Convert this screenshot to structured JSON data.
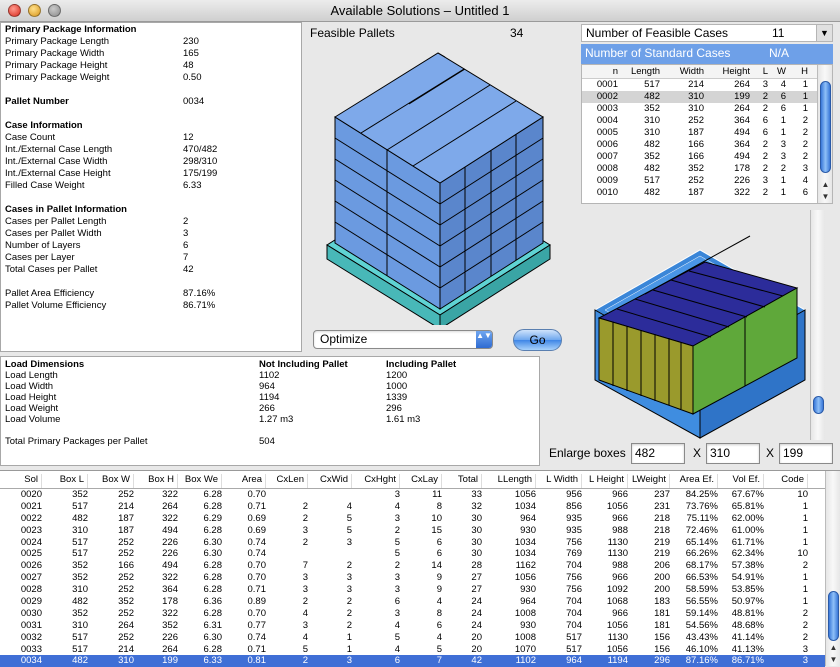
{
  "window": {
    "title": "Available Solutions – Untitled 1"
  },
  "info": {
    "primary_header": "Primary Package Information",
    "primary": [
      [
        "Primary Package Length",
        "230"
      ],
      [
        "Primary Package Width",
        "165"
      ],
      [
        "Primary Package Height",
        "48"
      ],
      [
        "Primary Package Weight",
        "0.50"
      ]
    ],
    "pallet_number": [
      "Pallet Number",
      "0034"
    ],
    "case_header": "Case Information",
    "case": [
      [
        "Case Count",
        "12"
      ],
      [
        "Int./External Case Length",
        "470/482"
      ],
      [
        "Int./External Case Width",
        "298/310"
      ],
      [
        "Int./External Case Height",
        "175/199"
      ],
      [
        "Filled Case Weight",
        "6.33"
      ]
    ],
    "cases_header": "Cases in Pallet Information",
    "cases": [
      [
        "Cases per Pallet Length",
        "2"
      ],
      [
        "Cases per Pallet Width",
        "3"
      ],
      [
        "Number of Layers",
        "6"
      ],
      [
        "Cases per Layer",
        "7"
      ],
      [
        "Total Cases per Pallet",
        "42"
      ]
    ],
    "eff": [
      [
        "Pallet Area Efficiency",
        "87.16%"
      ],
      [
        "Pallet Volume Efficiency",
        "86.71%"
      ]
    ]
  },
  "feasible": {
    "label": "Feasible Pallets",
    "count": "34"
  },
  "optimize": {
    "value": "Optimize",
    "arrow": "▲▼"
  },
  "go_label": "Go",
  "load": {
    "title": "Load Dimensions",
    "col1": "Not Including Pallet",
    "col2": "Including Pallet",
    "rows": [
      [
        "Load Length",
        "1102",
        "1200"
      ],
      [
        "Load Width",
        "964",
        "1000"
      ],
      [
        "Load Height",
        "1194",
        "1339"
      ],
      [
        "Load Weight",
        "266",
        "296"
      ],
      [
        "Load Volume",
        "1.27 m3",
        "1.61 m3"
      ]
    ],
    "total_label": "Total Primary Packages per Pallet",
    "total_value": "504"
  },
  "cases_panel": {
    "nfc_label": "Number of Feasible Cases",
    "nfc_value": "11",
    "nfc_arrow": "▼",
    "nsc_label": "Number of Standard Cases",
    "nsc_value": "N/A",
    "headers": [
      "n",
      "Length",
      "Width",
      "Height",
      "L",
      "W",
      "H"
    ],
    "rows": [
      [
        "0001",
        "517",
        "214",
        "264",
        "3",
        "4",
        "1"
      ],
      [
        "0002",
        "482",
        "310",
        "199",
        "2",
        "6",
        "1"
      ],
      [
        "0003",
        "352",
        "310",
        "264",
        "2",
        "6",
        "1"
      ],
      [
        "0004",
        "310",
        "252",
        "364",
        "6",
        "1",
        "2"
      ],
      [
        "0005",
        "310",
        "187",
        "494",
        "6",
        "1",
        "2"
      ],
      [
        "0006",
        "482",
        "166",
        "364",
        "2",
        "3",
        "2"
      ],
      [
        "0007",
        "352",
        "166",
        "494",
        "2",
        "3",
        "2"
      ],
      [
        "0008",
        "482",
        "352",
        "178",
        "2",
        "2",
        "3"
      ],
      [
        "0009",
        "517",
        "252",
        "226",
        "3",
        "1",
        "4"
      ],
      [
        "0010",
        "482",
        "187",
        "322",
        "2",
        "1",
        "6"
      ]
    ],
    "selected": 1
  },
  "enlarge": {
    "label": "Enlarge boxes",
    "l": "482",
    "w": "310",
    "h": "199",
    "x": "X"
  },
  "solutions": {
    "headers": [
      "Sol",
      "Box L",
      "Box W",
      "Box H",
      "Box We",
      "Area",
      "CxLen",
      "CxWid",
      "CxHght",
      "CxLay",
      "Total",
      "LLength",
      "L Width",
      "L Height",
      "LWeight",
      "Area Ef.",
      "Vol Ef.",
      "Code"
    ],
    "rows": [
      [
        "0020",
        "352",
        "252",
        "322",
        "6.28",
        "0.70",
        "",
        "",
        "3",
        "11",
        "33",
        "1056",
        "956",
        "966",
        "237",
        "84.25%",
        "67.67%",
        "10"
      ],
      [
        "0021",
        "517",
        "214",
        "264",
        "6.28",
        "0.71",
        "2",
        "4",
        "4",
        "8",
        "32",
        "1034",
        "856",
        "1056",
        "231",
        "73.76%",
        "65.81%",
        "1"
      ],
      [
        "0022",
        "482",
        "187",
        "322",
        "6.29",
        "0.69",
        "2",
        "5",
        "3",
        "10",
        "30",
        "964",
        "935",
        "966",
        "218",
        "75.11%",
        "62.00%",
        "1"
      ],
      [
        "0023",
        "310",
        "187",
        "494",
        "6.28",
        "0.69",
        "3",
        "5",
        "2",
        "15",
        "30",
        "930",
        "935",
        "988",
        "218",
        "72.46%",
        "61.00%",
        "1"
      ],
      [
        "0024",
        "517",
        "252",
        "226",
        "6.30",
        "0.74",
        "2",
        "3",
        "5",
        "6",
        "30",
        "1034",
        "756",
        "1130",
        "219",
        "65.14%",
        "61.71%",
        "1"
      ],
      [
        "0025",
        "517",
        "252",
        "226",
        "6.30",
        "0.74",
        "",
        "",
        "5",
        "6",
        "30",
        "1034",
        "769",
        "1130",
        "219",
        "66.26%",
        "62.34%",
        "10"
      ],
      [
        "0026",
        "352",
        "166",
        "494",
        "6.28",
        "0.70",
        "7",
        "2",
        "2",
        "14",
        "28",
        "1162",
        "704",
        "988",
        "206",
        "68.17%",
        "57.38%",
        "2"
      ],
      [
        "0027",
        "352",
        "252",
        "322",
        "6.28",
        "0.70",
        "3",
        "3",
        "3",
        "9",
        "27",
        "1056",
        "756",
        "966",
        "200",
        "66.53%",
        "54.91%",
        "1"
      ],
      [
        "0028",
        "310",
        "252",
        "364",
        "6.28",
        "0.71",
        "3",
        "3",
        "3",
        "9",
        "27",
        "930",
        "756",
        "1092",
        "200",
        "58.59%",
        "53.85%",
        "1"
      ],
      [
        "0029",
        "482",
        "352",
        "178",
        "6.36",
        "0.89",
        "2",
        "2",
        "6",
        "4",
        "24",
        "964",
        "704",
        "1068",
        "183",
        "56.55%",
        "50.97%",
        "1"
      ],
      [
        "0030",
        "352",
        "252",
        "322",
        "6.28",
        "0.70",
        "4",
        "2",
        "3",
        "8",
        "24",
        "1008",
        "704",
        "966",
        "181",
        "59.14%",
        "48.81%",
        "2"
      ],
      [
        "0031",
        "310",
        "264",
        "352",
        "6.31",
        "0.77",
        "3",
        "2",
        "4",
        "6",
        "24",
        "930",
        "704",
        "1056",
        "181",
        "54.56%",
        "48.68%",
        "2"
      ],
      [
        "0032",
        "517",
        "252",
        "226",
        "6.30",
        "0.74",
        "4",
        "1",
        "5",
        "4",
        "20",
        "1008",
        "517",
        "1130",
        "156",
        "43.43%",
        "41.14%",
        "2"
      ],
      [
        "0033",
        "517",
        "214",
        "264",
        "6.28",
        "0.71",
        "5",
        "1",
        "4",
        "5",
        "20",
        "1070",
        "517",
        "1056",
        "156",
        "46.10%",
        "41.13%",
        "3"
      ],
      [
        "0034",
        "482",
        "310",
        "199",
        "6.33",
        "0.81",
        "2",
        "3",
        "6",
        "7",
        "42",
        "1102",
        "964",
        "1194",
        "296",
        "87.16%",
        "86.71%",
        "3"
      ]
    ],
    "selected": 14
  },
  "colors": {
    "case_blue": "#6b9ae0",
    "pallet_teal": "#5fd3d3",
    "inner_navy": "#2c2c9a",
    "green": "#5fa83a",
    "olive": "#9a9a2c",
    "container": "#3a86d8",
    "highlight": "#3f6fd6"
  }
}
